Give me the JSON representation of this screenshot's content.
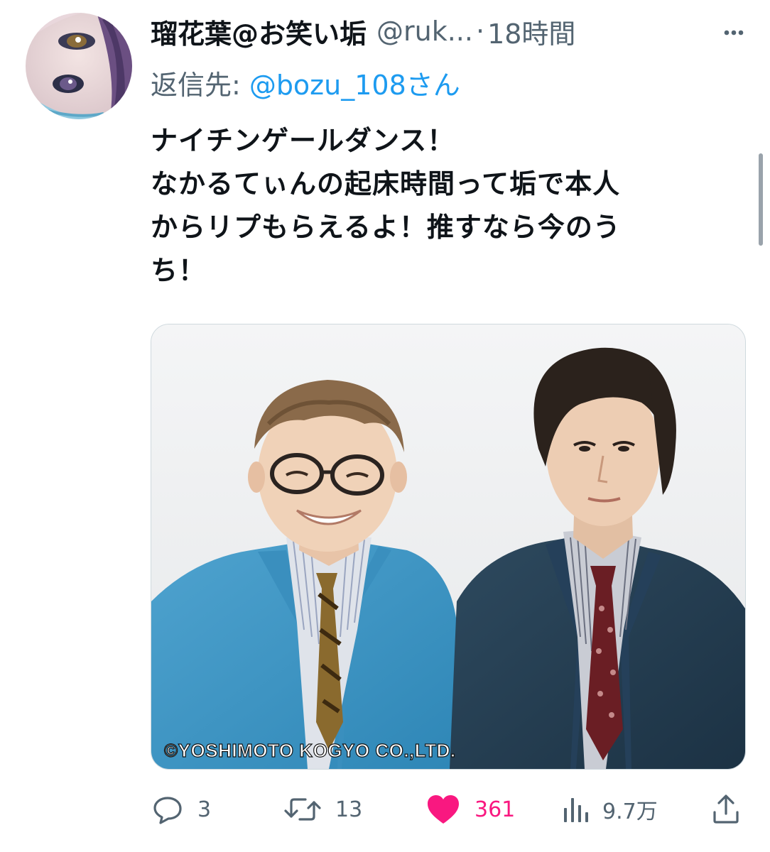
{
  "tweet": {
    "display_name": "瑠花葉@お笑い垢",
    "handle": "@ruk...",
    "separator": "·",
    "time": "18時間",
    "reply_prefix": "返信先:",
    "reply_target": "@bozu_108さん",
    "text_lines": [
      "ナイチンゲールダンス！",
      "なかるてぃんの起床時間って垢で本人",
      "からリプもらえるよ！推すなら今のう",
      "ち！"
    ],
    "media": {
      "credit": "©YOSHIMOTO KOGYO CO.,LTD."
    },
    "actions": {
      "replies": "3",
      "retweets": "13",
      "likes": "361",
      "views": "9.7万"
    }
  },
  "colors": {
    "text": "#0f1419",
    "secondary": "#536471",
    "link": "#1d9bf0",
    "like": "#f91880"
  },
  "icons": {
    "reply": "speech-bubble-icon",
    "retweet": "retweet-arrows-icon",
    "like": "heart-filled-icon",
    "views": "bar-chart-icon",
    "share": "share-upload-icon",
    "more": "more-dots-icon"
  }
}
